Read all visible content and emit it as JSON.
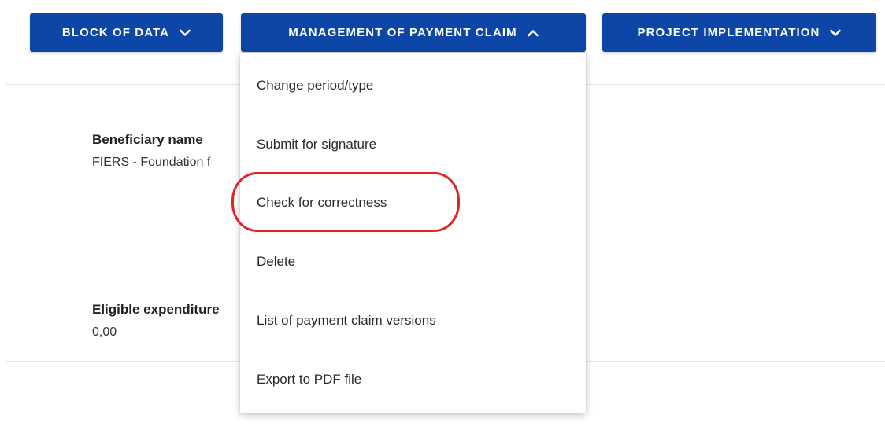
{
  "toolbar": {
    "block_of_data": "BLOCK OF DATA",
    "management_of_payment_claim": "MANAGEMENT OF PAYMENT CLAIM",
    "project_implementation": "PROJECT IMPLEMENTATION"
  },
  "fields": {
    "beneficiary_label": "Beneficiary name",
    "beneficiary_value": "FIERS - Foundation f",
    "eligible_label": "Eligible expenditure",
    "eligible_value": "0,00"
  },
  "menu": {
    "items": [
      {
        "label": "Change period/type"
      },
      {
        "label": "Submit for signature"
      },
      {
        "label": "Check for correctness"
      },
      {
        "label": "Delete"
      },
      {
        "label": "List of payment claim versions"
      },
      {
        "label": "Export to PDF file"
      }
    ]
  },
  "colors": {
    "primary": "#0d46a6",
    "highlight": "#e02424"
  }
}
